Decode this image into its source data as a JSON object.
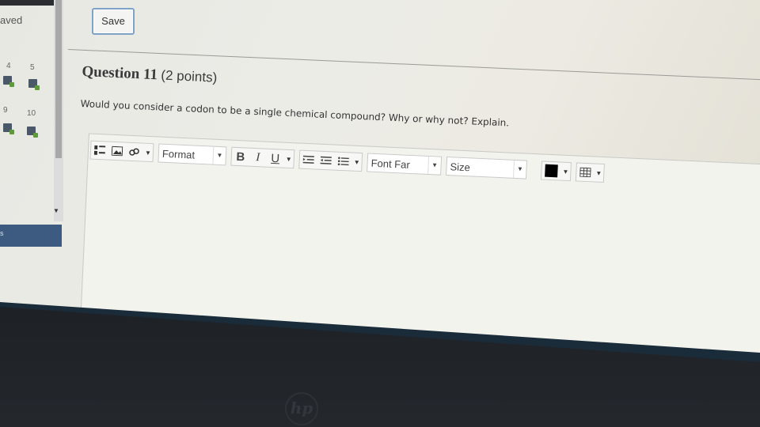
{
  "left_panel": {
    "saved_label": "aved",
    "question_numbers": [
      "4",
      "5",
      "9",
      "10"
    ],
    "blue_bar_label": "s"
  },
  "save_label": "Save",
  "question": {
    "title": "Question 11",
    "points": "(2 points)",
    "text": "Would you consider a codon to be a single chemical compound? Why or why not? Explain."
  },
  "toolbar": {
    "format_label": "Format",
    "bold_label": "B",
    "italic_label": "I",
    "underline_label": "U",
    "font_family_label": "Font Far",
    "size_label": "Size",
    "text_color": "#000000"
  },
  "editor": {
    "content": ""
  },
  "taskbar": {
    "help_label": "?"
  },
  "monitor": {
    "brand": "hp"
  }
}
